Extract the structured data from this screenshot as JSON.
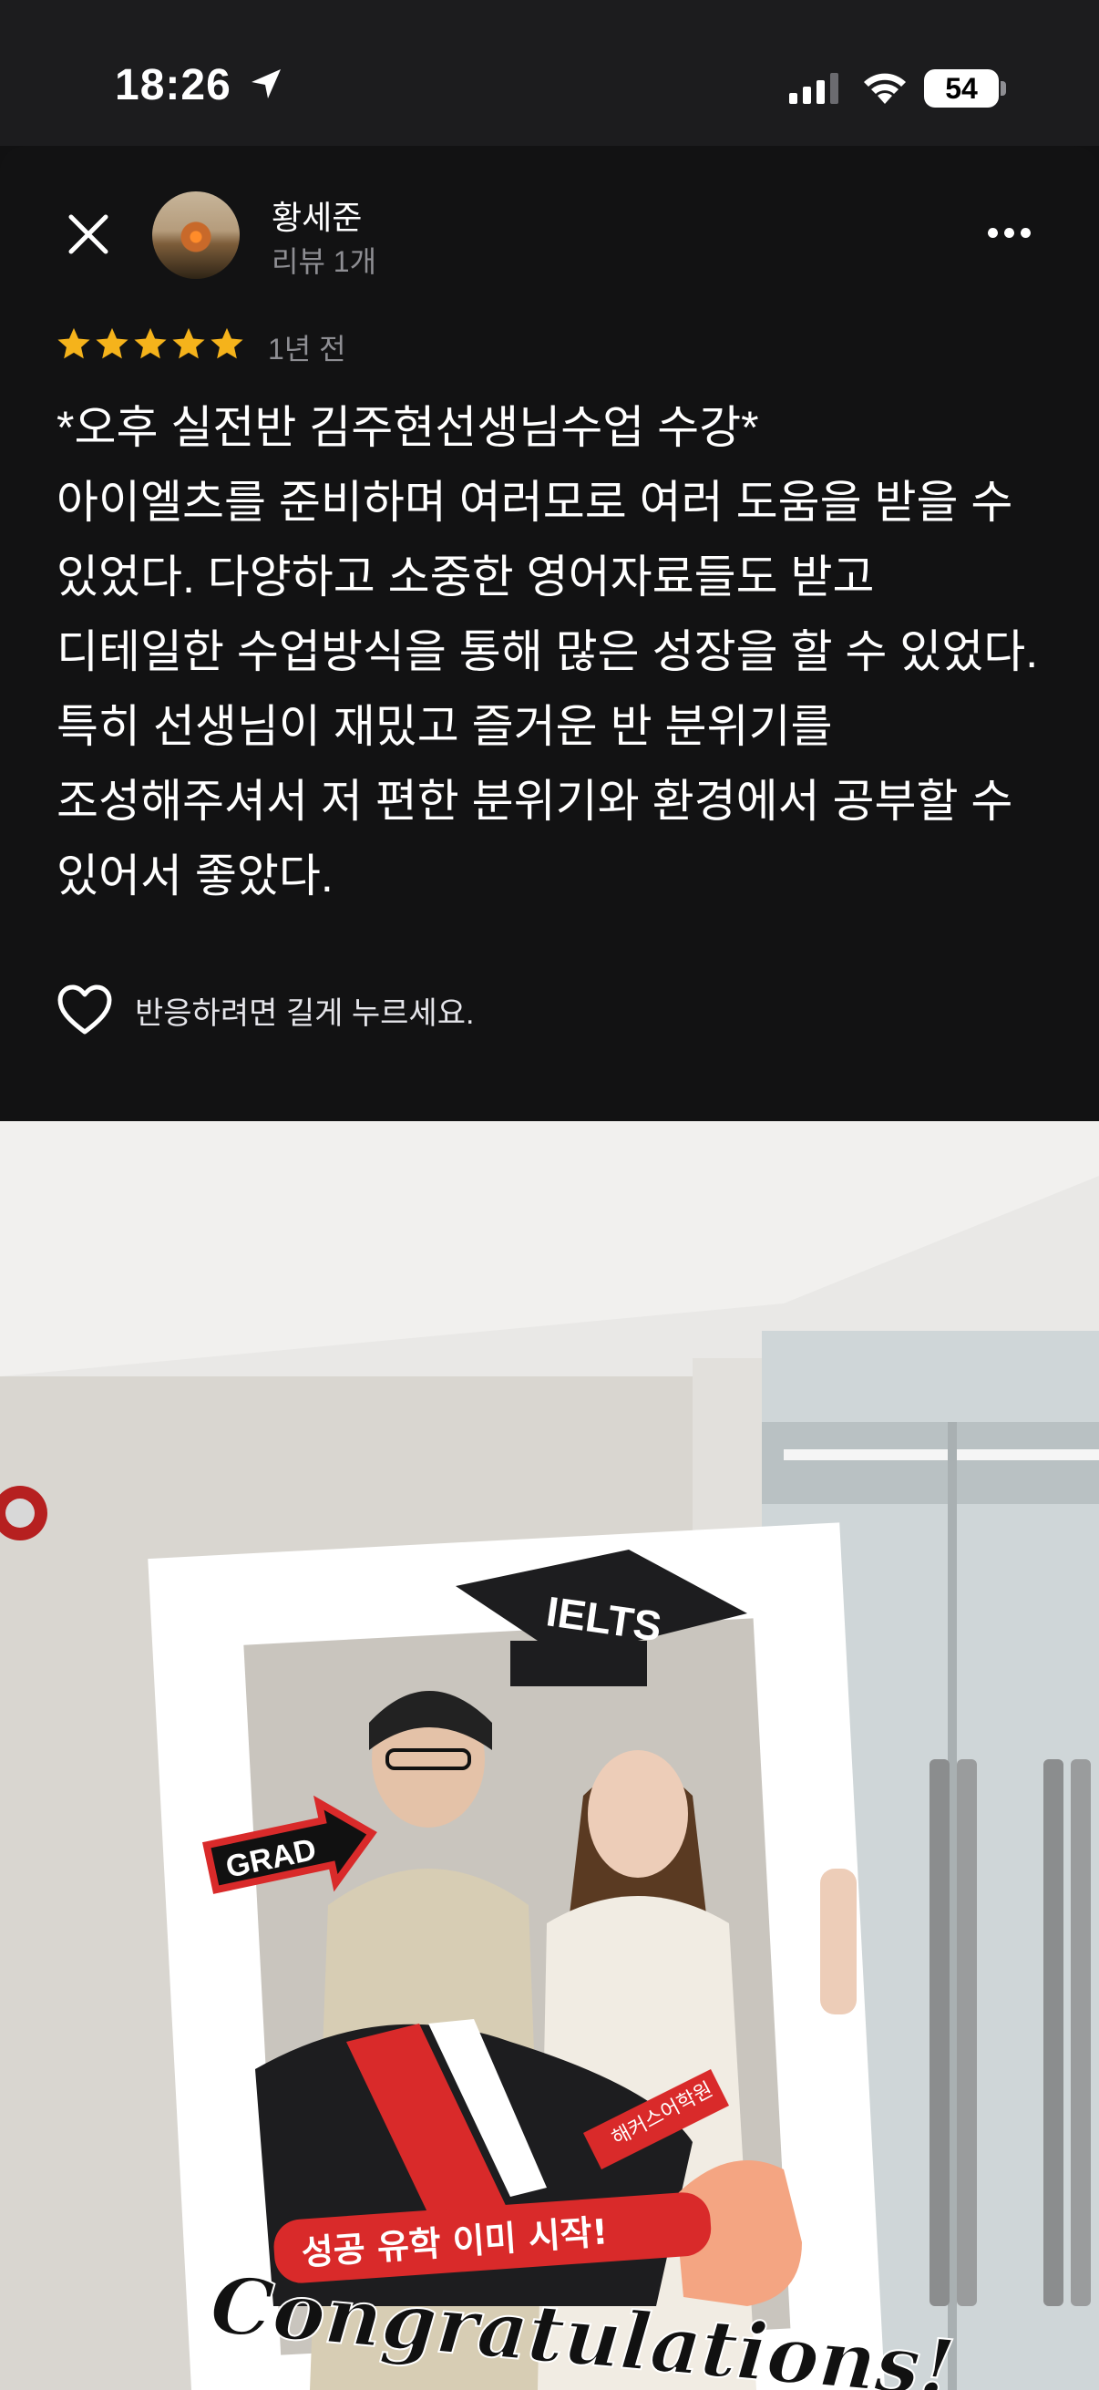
{
  "status_bar": {
    "time": "18:26",
    "battery": "54",
    "icons": [
      "location-arrow-icon",
      "cellular-signal-icon",
      "wifi-icon",
      "battery-icon"
    ]
  },
  "review": {
    "author_name": "황세준",
    "author_meta": "리뷰 1개",
    "rating": 5,
    "date": "1년 전",
    "paragraphs": [
      "*오후 실전반 김주현선생님수업 수강*",
      "아이엘츠를 준비하며 여러모로 여러 도움을 받을 수 있었다. 다양하고 소중한 영어자료들도 받고 디테일한 수업방식을 통해 많은 성장을 할 수 있었다. 특히 선생님이 재밌고 즐거운 반 분위기를 조성해주셔서 저 편한 분위기와 환경에서 공부할 수 있어서 좋았다."
    ],
    "reaction_hint": "반응하려면 길게 누르세요."
  },
  "photo": {
    "frame_text": {
      "ielts": "IELTS",
      "grad": "GRAD",
      "banner": "성공 유학 이미 시작!",
      "congrats": "Congratulations!",
      "shirt_logo": "해커스어학원"
    }
  },
  "colors": {
    "background": "#111112",
    "star": "#f5b31b",
    "muted": "#8e8e93"
  }
}
